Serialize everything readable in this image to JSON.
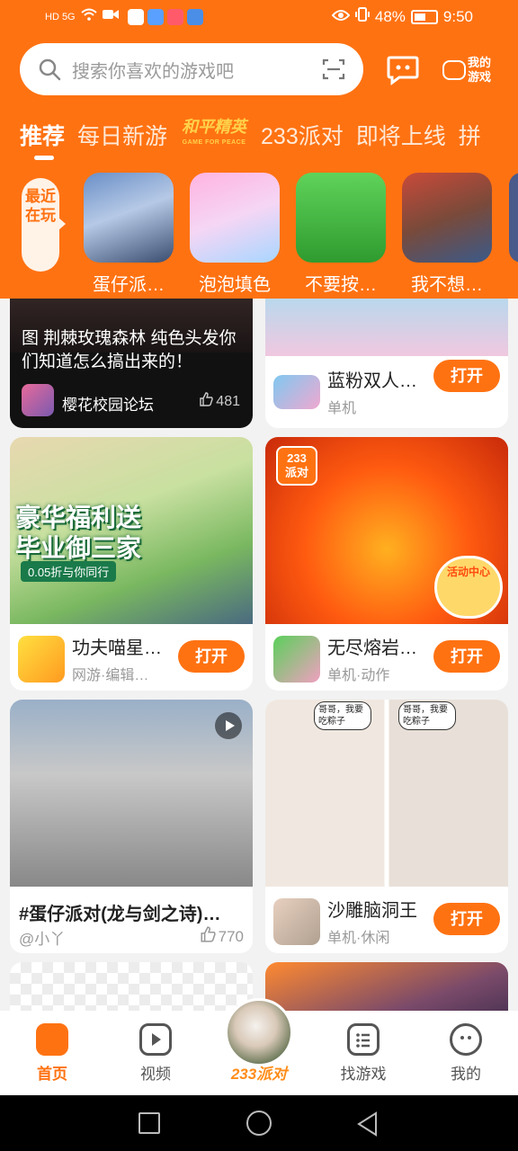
{
  "status_bar": {
    "left_signal": "HD 5G",
    "battery_percent": "48%",
    "time": "9:50"
  },
  "search": {
    "placeholder": "搜索你喜欢的游戏吧"
  },
  "my_games_label": "我的游戏",
  "tabs": [
    {
      "label": "推荐",
      "active": true
    },
    {
      "label": "每日新游"
    },
    {
      "label": "和平精英",
      "logo_sub": "GAME FOR PEACE"
    },
    {
      "label": "233派对"
    },
    {
      "label": "即将上线"
    },
    {
      "label": "拼"
    }
  ],
  "recent": {
    "label": "最近在玩",
    "items": [
      {
        "name": "蛋仔派…"
      },
      {
        "name": "泡泡填色"
      },
      {
        "name": "不要按…"
      },
      {
        "name": "我不想…"
      }
    ]
  },
  "feed": {
    "card1": {
      "text": "图  荆棘玫瑰森林  纯色头发你们知道怎么搞出来的！",
      "forum": "樱花校园论坛",
      "likes": "481"
    },
    "card2": {
      "title": "蓝粉双人…",
      "sub": "单机",
      "button": "打开"
    },
    "card3": {
      "title": "功夫喵星…",
      "sub": "网游·编辑…",
      "button": "打开",
      "banner_line1": "豪华福利送",
      "banner_line2": "毕业御三家",
      "banner_line3": "0.05折与你同行"
    },
    "card4": {
      "title": "无尽熔岩…",
      "sub": "单机·动作",
      "button": "打开",
      "badge": "233派对",
      "activity": "活动中心"
    },
    "card5": {
      "title": "#蛋仔派对(龙与剑之诗)…",
      "author": "@小丫",
      "likes": "770"
    },
    "card6": {
      "title": "沙雕脑洞王",
      "sub": "单机·休闲",
      "button": "打开",
      "bubble": "哥哥，我要吃粽子"
    }
  },
  "bottom_nav": [
    {
      "label": "首页",
      "active": true
    },
    {
      "label": "视频"
    },
    {
      "label": "233派对"
    },
    {
      "label": "找游戏"
    },
    {
      "label": "我的"
    }
  ],
  "colors": {
    "accent": "#ff7212"
  }
}
